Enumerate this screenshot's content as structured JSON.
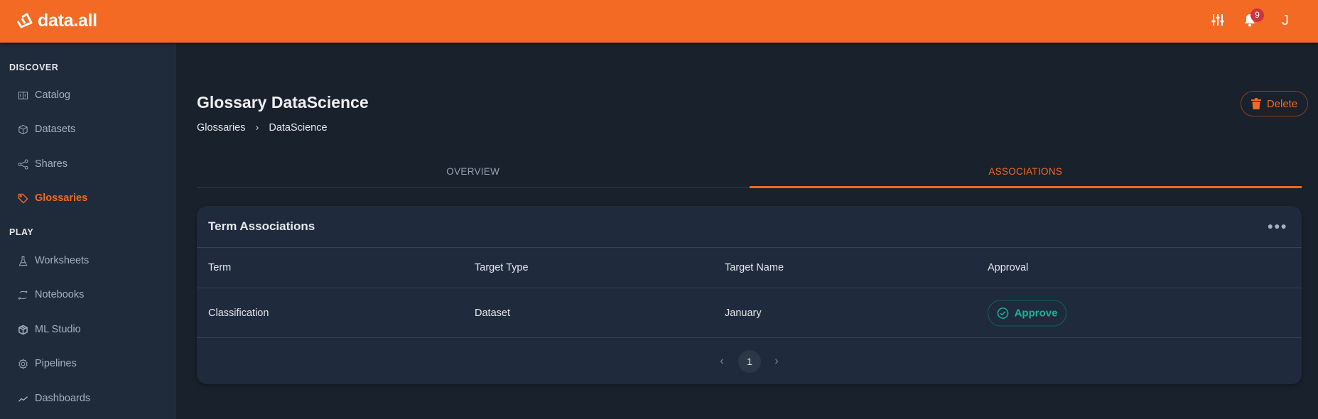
{
  "app": {
    "name": "data.all",
    "notification_count": "9",
    "user_initial": "J"
  },
  "sidebar": {
    "sections": [
      {
        "label": "DISCOVER"
      },
      {
        "label": "PLAY"
      }
    ],
    "items": [
      {
        "label": "Catalog"
      },
      {
        "label": "Datasets"
      },
      {
        "label": "Shares"
      },
      {
        "label": "Glossaries"
      },
      {
        "label": "Worksheets"
      },
      {
        "label": "Notebooks"
      },
      {
        "label": "ML Studio"
      },
      {
        "label": "Pipelines"
      },
      {
        "label": "Dashboards"
      }
    ]
  },
  "page": {
    "title": "Glossary DataScience",
    "breadcrumb": [
      "Glossaries",
      "DataScience"
    ],
    "delete_label": "Delete"
  },
  "tabs": [
    {
      "label": "OVERVIEW"
    },
    {
      "label": "ASSOCIATIONS"
    }
  ],
  "card": {
    "title": "Term Associations",
    "columns": [
      "Term",
      "Target Type",
      "Target Name",
      "Approval"
    ],
    "rows": [
      {
        "term": "Classification",
        "target_type": "Dataset",
        "target_name": "January",
        "action": "Approve"
      }
    ],
    "pagination": {
      "current": "1"
    }
  },
  "colors": {
    "brand": "#f26a24",
    "approve": "#19b3a0"
  }
}
